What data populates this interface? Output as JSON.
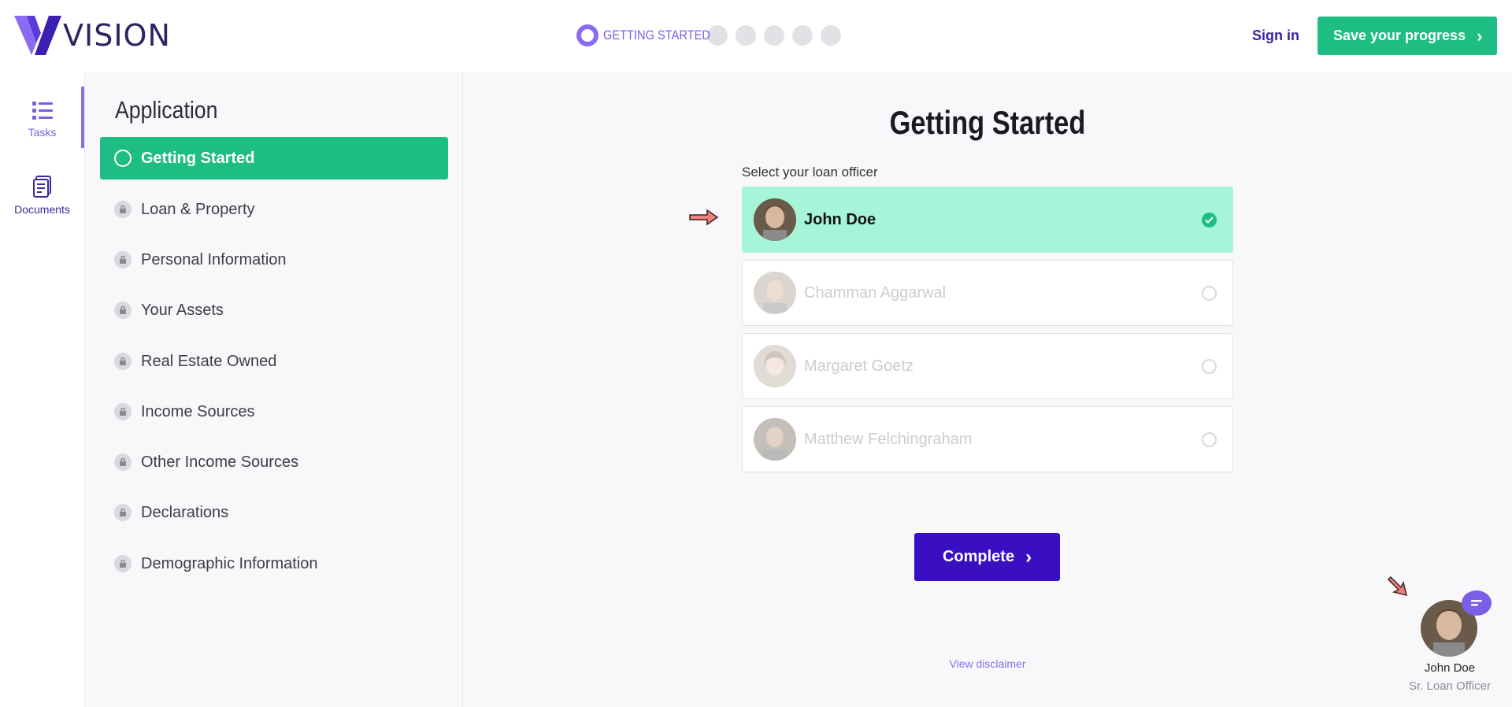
{
  "brand": {
    "logo_text": "VISION",
    "accent": "#8b6cf0",
    "primary": "#3a0fc2",
    "success": "#1ebd83"
  },
  "header": {
    "progress": {
      "current_step_label": "GETTING STARTED",
      "current_step": 1,
      "total_steps": 6
    },
    "signin_label": "Sign in",
    "save_label": "Save your progress"
  },
  "rail": {
    "items": [
      {
        "label": "Tasks",
        "icon": "list-icon",
        "active": true
      },
      {
        "label": "Documents",
        "icon": "document-icon",
        "active": false
      }
    ]
  },
  "sidebar": {
    "title": "Application",
    "items": [
      {
        "label": "Getting Started",
        "state": "active"
      },
      {
        "label": "Loan & Property",
        "state": "locked"
      },
      {
        "label": "Personal Information",
        "state": "locked"
      },
      {
        "label": "Your Assets",
        "state": "locked"
      },
      {
        "label": "Real Estate Owned",
        "state": "locked"
      },
      {
        "label": "Income Sources",
        "state": "locked"
      },
      {
        "label": "Other Income Sources",
        "state": "locked"
      },
      {
        "label": "Declarations",
        "state": "locked"
      },
      {
        "label": "Demographic Information",
        "state": "locked"
      }
    ]
  },
  "main": {
    "title": "Getting Started",
    "select_label": "Select your loan officer",
    "officers": [
      {
        "name": "John Doe",
        "selected": true
      },
      {
        "name": "Chamman Aggarwal",
        "selected": false
      },
      {
        "name": "Margaret Goetz",
        "selected": false
      },
      {
        "name": "Matthew Felchingraham",
        "selected": false
      }
    ],
    "complete_label": "Complete",
    "disclaimer_label": "View disclaimer"
  },
  "widget": {
    "name": "John Doe",
    "role": "Sr. Loan Officer"
  }
}
